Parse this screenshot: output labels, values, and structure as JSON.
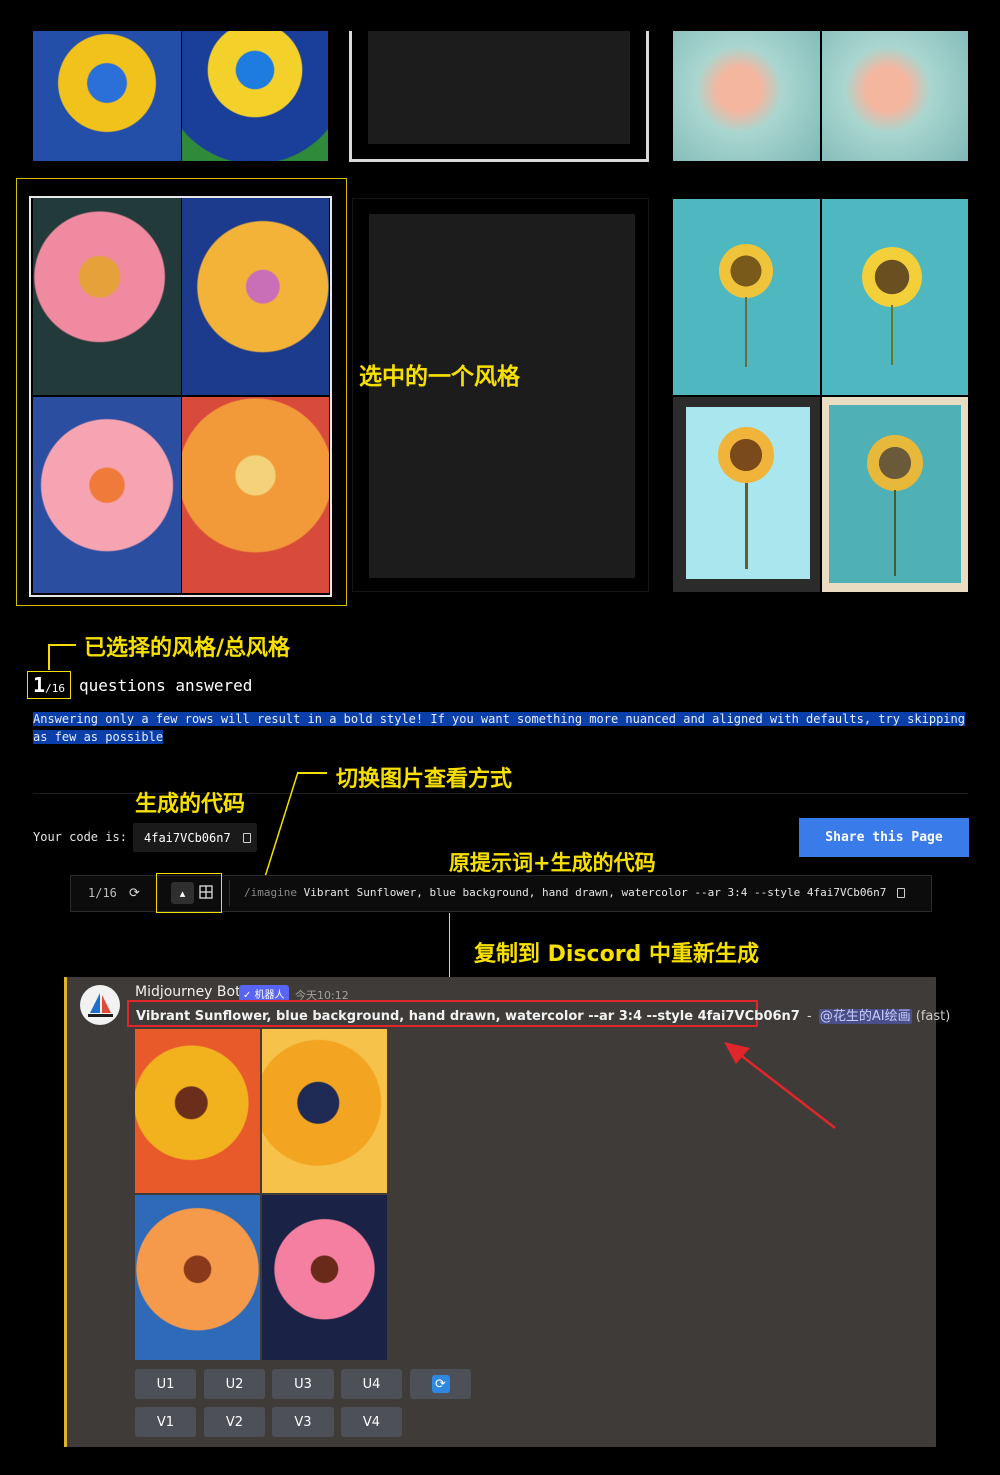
{
  "annotations": {
    "selected_style": "选中的一个风格",
    "selected_over_total": "已选择的风格/总风格",
    "generated_code": "生成的代码",
    "toggle_view": "切换图片查看方式",
    "prompt_plus_code": "原提示词+生成的代码",
    "copy_to_discord": "复制到 Discord 中重新生成"
  },
  "progress": {
    "count": "1",
    "total": "/16",
    "label": "questions answered",
    "hint": "Answering only a few rows will result in a bold style! If you want something more nuanced and aligned with defaults, try skipping as few as possible"
  },
  "code": {
    "label": "Your code is:",
    "value": "4fai7VCb06n7",
    "share_button": "Share this Page"
  },
  "prompt_bar": {
    "counter": "1/16",
    "command": "/imagine",
    "prompt": "Vibrant Sunflower, blue background, hand drawn, watercolor --ar 3:4 --style 4fai7VCb06n7"
  },
  "discord": {
    "bot_name": "Midjourney Bot",
    "bot_badge": "✓ 机器人",
    "timestamp": "今天10:12",
    "message": "Vibrant Sunflower, blue background, hand drawn, watercolor --ar 3:4 --style 4fai7VCb06n7",
    "separator": "-",
    "mention": "@花生的AI绘画",
    "speed": "(fast)",
    "buttons_row1": [
      "U1",
      "U2",
      "U3",
      "U4"
    ],
    "buttons_row2": [
      "V1",
      "V2",
      "V3",
      "V4"
    ]
  },
  "colors": {
    "annotation": "#f7e000",
    "share_button": "#3a7bea",
    "discord_bg": "#3e3b38",
    "highlight_box": "#e0262b",
    "selection_bg": "#0a3ea8"
  }
}
